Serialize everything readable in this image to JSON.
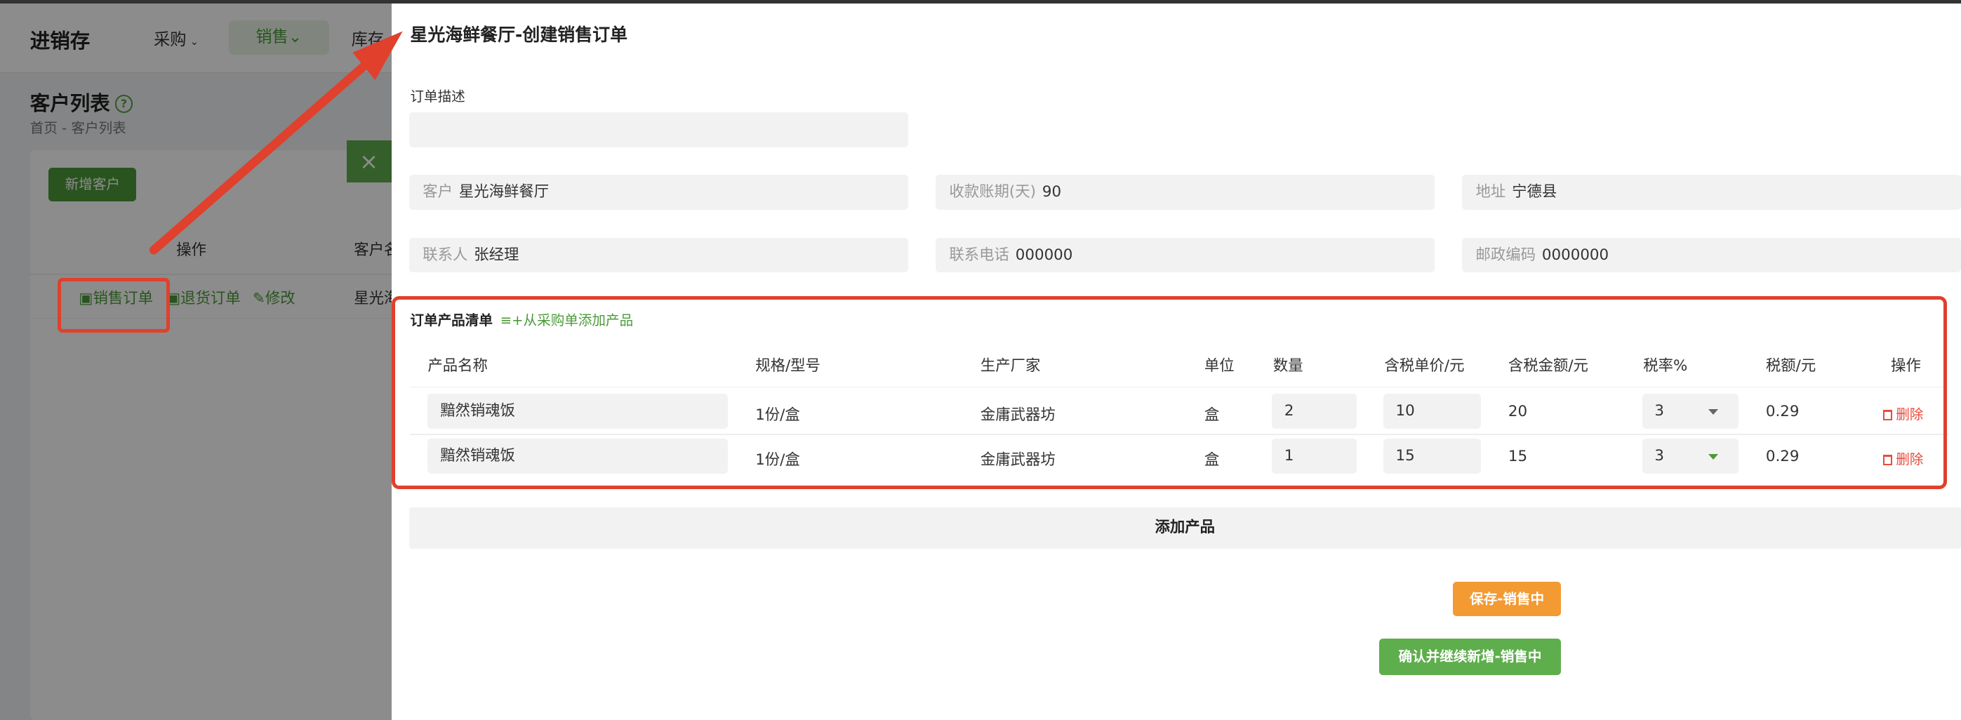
{
  "background": {
    "app_title": "进销存",
    "menu": [
      "采购",
      "销售",
      "库存"
    ],
    "menu_active": "销售",
    "page_title": "客户列表",
    "breadcrumb": "首页 - 客户列表",
    "add_customer": "新增客户",
    "col_action": "操作",
    "col_customer": "客户名",
    "row_action_sale": "销售订单",
    "row_action_return": "退货订单",
    "row_action_edit": "修改",
    "row_customer": "星光海"
  },
  "drawer": {
    "title": "星光海鲜餐厅-创建销售订单",
    "order_desc_label": "订单描述",
    "order_desc_value": "",
    "fields": {
      "customer_label": "客户",
      "customer_value": "星光海鲜餐厅",
      "term_label": "收款账期(天)",
      "term_value": "90",
      "address_label": "地址",
      "address_value": "宁德县",
      "contact_label": "联系人",
      "contact_value": "张经理",
      "phone_label": "联系电话",
      "phone_value": "000000",
      "zip_label": "邮政编码",
      "zip_value": "0000000"
    },
    "product_section_title": "订单产品清单",
    "add_from_purchase": "从采购单添加产品",
    "columns": [
      "产品名称",
      "规格/型号",
      "生产厂家",
      "单位",
      "数量",
      "含税单价/元",
      "含税金额/元",
      "税率%",
      "税额/元",
      "操作"
    ],
    "rows": [
      {
        "name": "黯然销魂饭",
        "spec": "1份/盒",
        "maker": "金庸武器坊",
        "unit": "盒",
        "qty": "2",
        "price": "10",
        "amount": "20",
        "tax_rate": "3",
        "tax": "0.29",
        "action": "删除"
      },
      {
        "name": "黯然销魂饭",
        "spec": "1份/盒",
        "maker": "金庸武器坊",
        "unit": "盒",
        "qty": "1",
        "price": "15",
        "amount": "15",
        "tax_rate": "3",
        "tax": "0.29",
        "action": "删除"
      }
    ],
    "add_product": "添加产品",
    "save_button": "保存-销售中",
    "confirm_button": "确认并继续新增-销售中"
  },
  "close_icon": "×",
  "colors": {
    "accent_green": "#4c9a3a",
    "orange": "#f39a32",
    "annotation_red": "#e0402c"
  }
}
